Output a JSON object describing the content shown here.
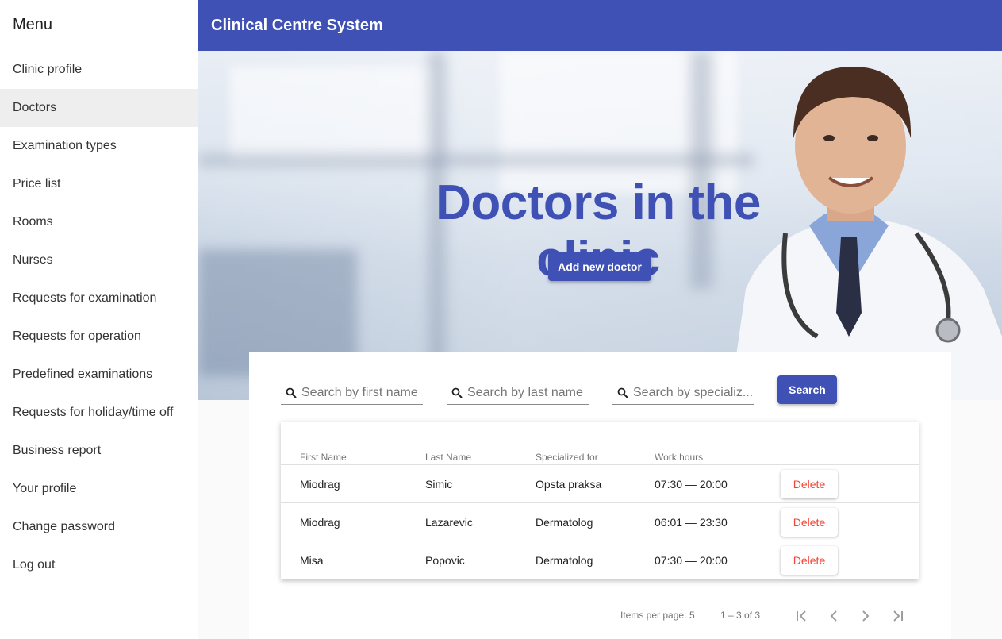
{
  "sidebar": {
    "title": "Menu",
    "items": [
      {
        "label": "Clinic profile"
      },
      {
        "label": "Doctors"
      },
      {
        "label": "Examination types"
      },
      {
        "label": "Price list"
      },
      {
        "label": "Rooms"
      },
      {
        "label": "Nurses"
      },
      {
        "label": "Requests for examination"
      },
      {
        "label": "Requests for operation"
      },
      {
        "label": "Predefined examinations"
      },
      {
        "label": "Requests for holiday/time off"
      },
      {
        "label": "Business report"
      },
      {
        "label": "Your profile"
      },
      {
        "label": "Change password"
      },
      {
        "label": "Log out"
      }
    ],
    "active_index": 1
  },
  "toolbar": {
    "title": "Clinical Centre System"
  },
  "hero": {
    "title": "Doctors in the clinic",
    "add_button": "Add new doctor"
  },
  "search": {
    "first_name_placeholder": "Search by first name",
    "last_name_placeholder": "Search by last name",
    "specialization_placeholder": "Search by specializ...",
    "button": "Search"
  },
  "table": {
    "columns": [
      "First Name",
      "Last Name",
      "Specialized for",
      "Work hours"
    ],
    "rows": [
      {
        "first_name": "Miodrag",
        "last_name": "Simic",
        "specialization": "Opsta praksa",
        "work_hours": "07:30 — 20:00",
        "action": "Delete"
      },
      {
        "first_name": "Miodrag",
        "last_name": "Lazarevic",
        "specialization": "Dermatolog",
        "work_hours": "06:01 — 23:30",
        "action": "Delete"
      },
      {
        "first_name": "Misa",
        "last_name": "Popovic",
        "specialization": "Dermatolog",
        "work_hours": "07:30 — 20:00",
        "action": "Delete"
      }
    ]
  },
  "paginator": {
    "items_per_page_label": "Items per page:",
    "items_per_page": "5",
    "range": "1 – 3 of 3"
  },
  "colors": {
    "primary": "#3f51b5",
    "warn": "#f44336"
  },
  "icons": [
    "search-icon",
    "first-page-icon",
    "previous-page-icon",
    "next-page-icon",
    "last-page-icon"
  ]
}
